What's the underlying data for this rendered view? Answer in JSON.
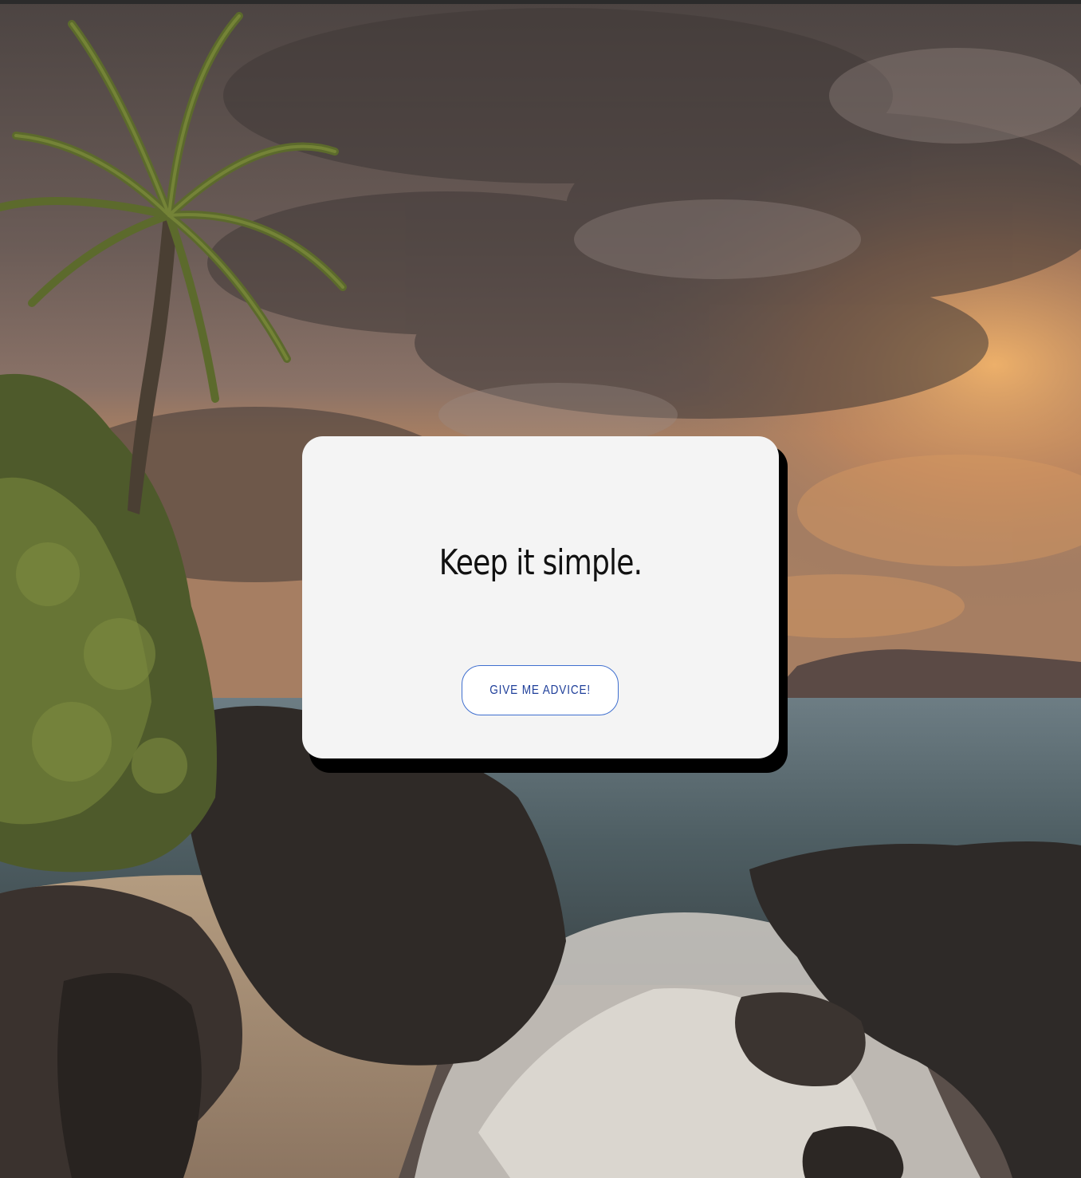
{
  "card": {
    "advice_text": "Keep it simple.",
    "button_label": "GIVE ME ADVICE!"
  },
  "colors": {
    "card_background": "#f4f4f4",
    "card_shadow": "#000000",
    "button_border": "#3f6fcf",
    "button_text": "#1f3f9a",
    "advice_text": "#111111"
  }
}
